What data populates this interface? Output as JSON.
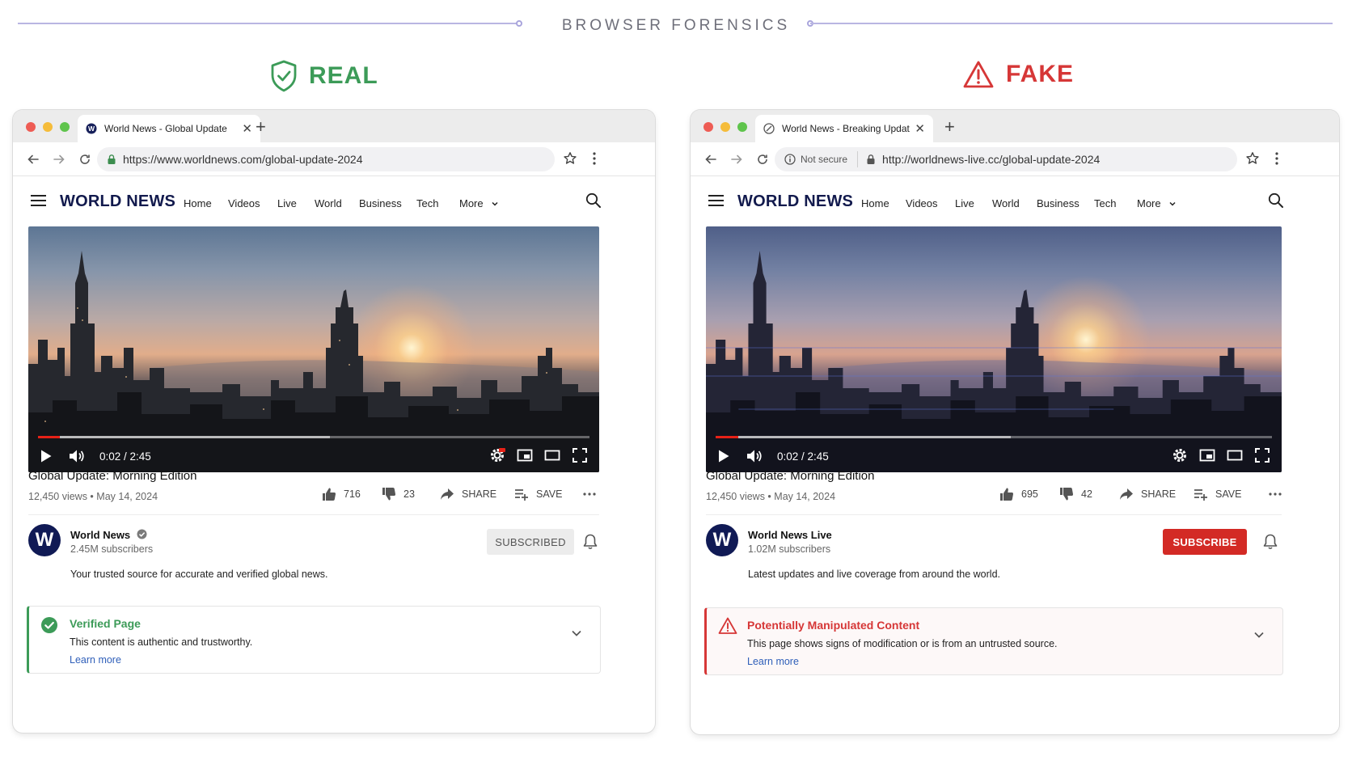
{
  "header": {
    "title": "BROWSER FORENSICS"
  },
  "colors": {
    "real": "#3c9b58",
    "fake": "#d63737",
    "brand_navy": "#121a4d",
    "subscribe_red": "#d32a25",
    "link_blue": "#2f5fb9"
  },
  "real": {
    "label": "REAL",
    "tab_title": "World News - Global Update",
    "url": "https://www.worldnews.com/global-update-2024",
    "brand": "WORLD NEWS",
    "nav": [
      "Home",
      "Videos",
      "Live",
      "World",
      "Business",
      "Tech",
      "More"
    ],
    "video": {
      "time": "0:02 / 2:45",
      "progress_fraction": 0.013,
      "buffered_fraction": 0.53
    },
    "video_title": "Global Update: Morning Edition",
    "views": "12,450 views • May 14, 2024",
    "likes": "716",
    "dislikes": "23",
    "share": "SHARE",
    "save": "SAVE",
    "channel": {
      "avatar_letter": "W",
      "name": "World News",
      "subscribers": "2.45M subscribers",
      "description": "Your trusted source for accurate and verified global news.",
      "button": "SUBSCRIBED"
    },
    "notice": {
      "title": "Verified Page",
      "text": "This content is authentic and trustworthy.",
      "link": "Learn more"
    }
  },
  "fake": {
    "label": "FAKE",
    "tab_title": "World News - Breaking Update",
    "security": "Not secure",
    "url": "http://worldnews-live.cc/global-update-2024",
    "brand": "WORLD NEWS",
    "nav": [
      "Home",
      "Videos",
      "Live",
      "World",
      "Business",
      "Tech",
      "More"
    ],
    "video": {
      "time": "0:02 / 2:45",
      "progress_fraction": 0.04,
      "buffered_fraction": 0.53
    },
    "video_title": "Global Update: Morning Edition",
    "views": "12,450 views • May 14, 2024",
    "likes": "695",
    "dislikes": "42",
    "share": "SHARE",
    "save": "SAVE",
    "channel": {
      "avatar_letter": "W",
      "name": "World News Live",
      "subscribers": "1.02M subscribers",
      "description": "Latest updates and live coverage from around the world.",
      "button": "SUBSCRIBE"
    },
    "notice": {
      "title": "Potentially Manipulated Content",
      "text": "This page shows signs of modification or is from an untrusted source.",
      "link": "Learn more"
    }
  }
}
